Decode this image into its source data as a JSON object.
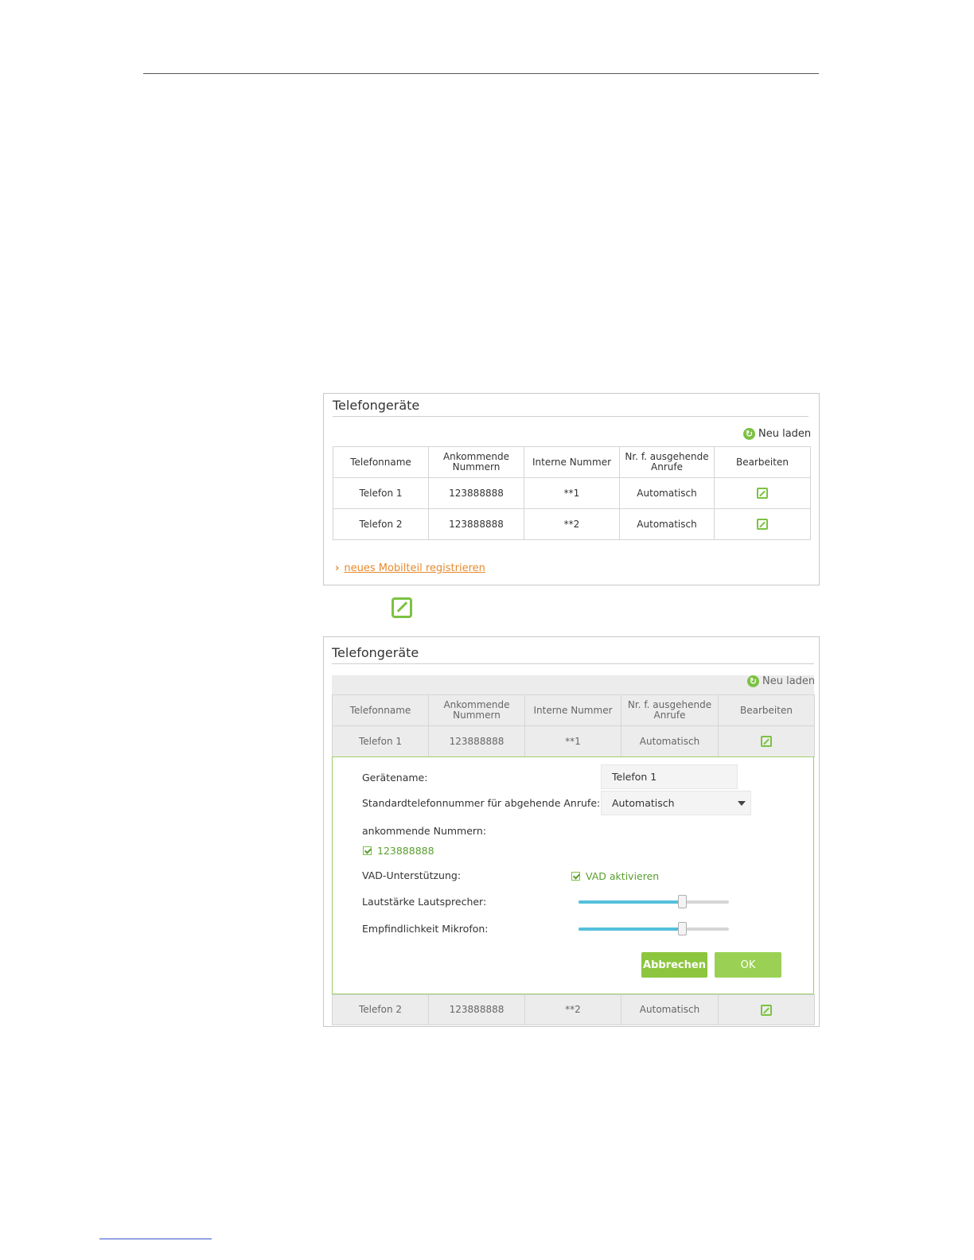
{
  "panel1": {
    "title": "Telefongeräte",
    "reload_label": "Neu laden",
    "columns": [
      "Telefonname",
      "Ankommende Nummern",
      "Interne Nummer",
      "Nr. f. ausgehende Anrufe",
      "Bearbeiten"
    ],
    "rows": [
      {
        "name": "Telefon 1",
        "incoming": "123888888",
        "internal": "**1",
        "outgoing": "Automatisch"
      },
      {
        "name": "Telefon 2",
        "incoming": "123888888",
        "internal": "**2",
        "outgoing": "Automatisch"
      }
    ],
    "register_link": "neues Mobilteil registrieren"
  },
  "panel2": {
    "title": "Telefongeräte",
    "reload_label": "Neu laden",
    "columns": [
      "Telefonname",
      "Ankommende Nummern",
      "Interne Nummer",
      "Nr. f. ausgehende Anrufe",
      "Bearbeiten"
    ],
    "rows": [
      {
        "name": "Telefon 1",
        "incoming": "123888888",
        "internal": "**1",
        "outgoing": "Automatisch"
      },
      {
        "name": "Telefon 2",
        "incoming": "123888888",
        "internal": "**2",
        "outgoing": "Automatisch"
      }
    ],
    "form": {
      "device_name_label": "Gerätename:",
      "device_name_value": "Telefon 1",
      "default_number_label": "Standardtelefonnummer für abgehende Anrufe:",
      "default_number_value": "Automatisch",
      "incoming_label": "ankommende Nummern:",
      "incoming_option": "123888888",
      "vad_label": "VAD-Unterstützung:",
      "vad_option": "VAD aktivieren",
      "speaker_label": "Lautstärke Lautsprecher:",
      "speaker_level": 0.69,
      "mic_label": "Empfindlichkeit Mikrofon:",
      "mic_level": 0.69,
      "cancel_label": "Abbrechen",
      "ok_label": "OK"
    }
  },
  "colors": {
    "accent_green": "#8cc63e",
    "link_orange": "#e68a2e",
    "slider_blue": "#55c0dc"
  },
  "icons": [
    "refresh-icon",
    "edit-icon",
    "chevron-right-icon",
    "checkbox-icon",
    "dropdown-arrow-icon"
  ]
}
